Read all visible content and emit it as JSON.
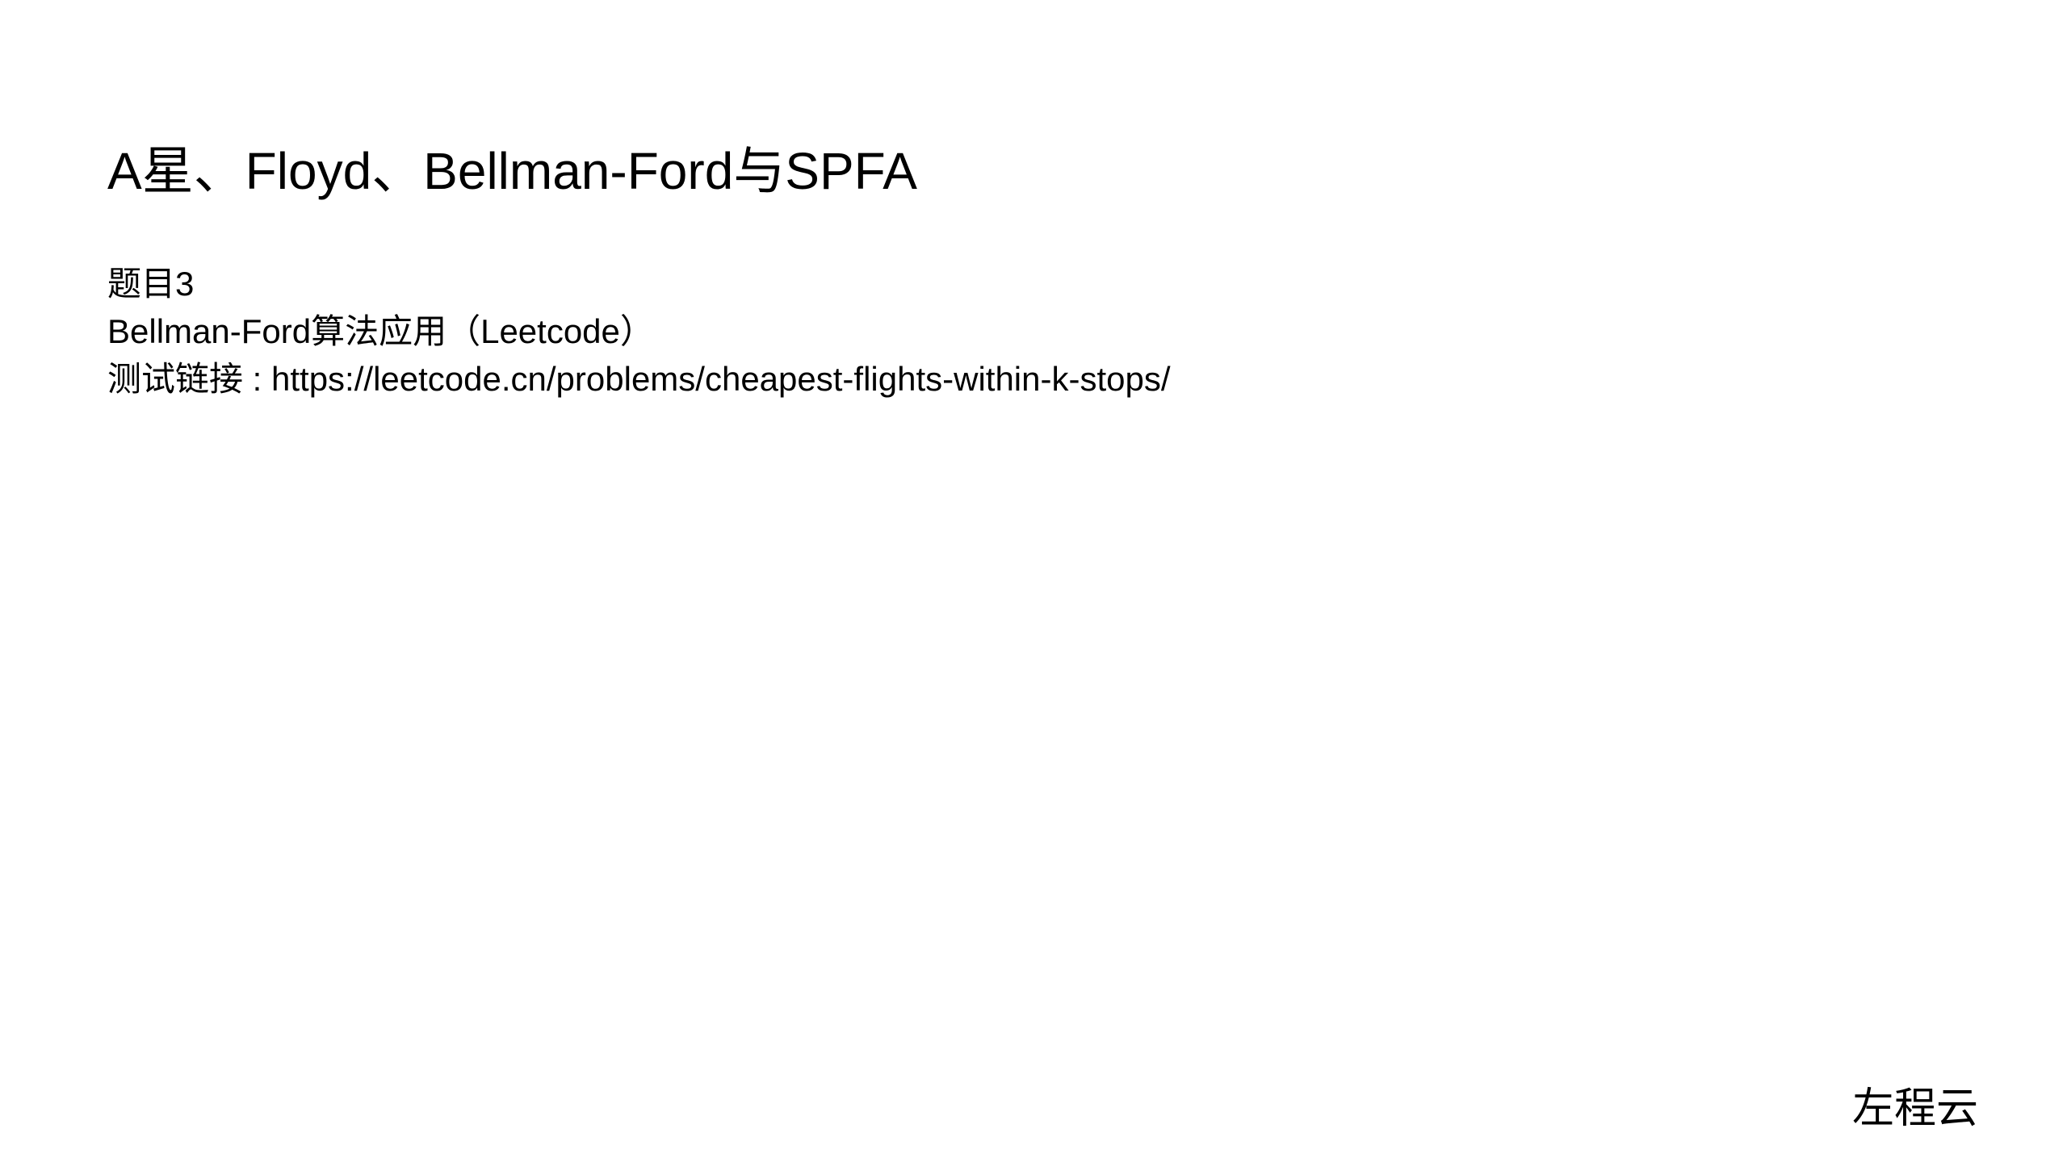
{
  "slide": {
    "title": "A星、Floyd、Bellman-Ford与SPFA",
    "lines": [
      "题目3",
      "Bellman-Ford算法应用（Leetcode）",
      "测试链接 : https://leetcode.cn/problems/cheapest-flights-within-k-stops/"
    ],
    "footer": "左程云"
  }
}
